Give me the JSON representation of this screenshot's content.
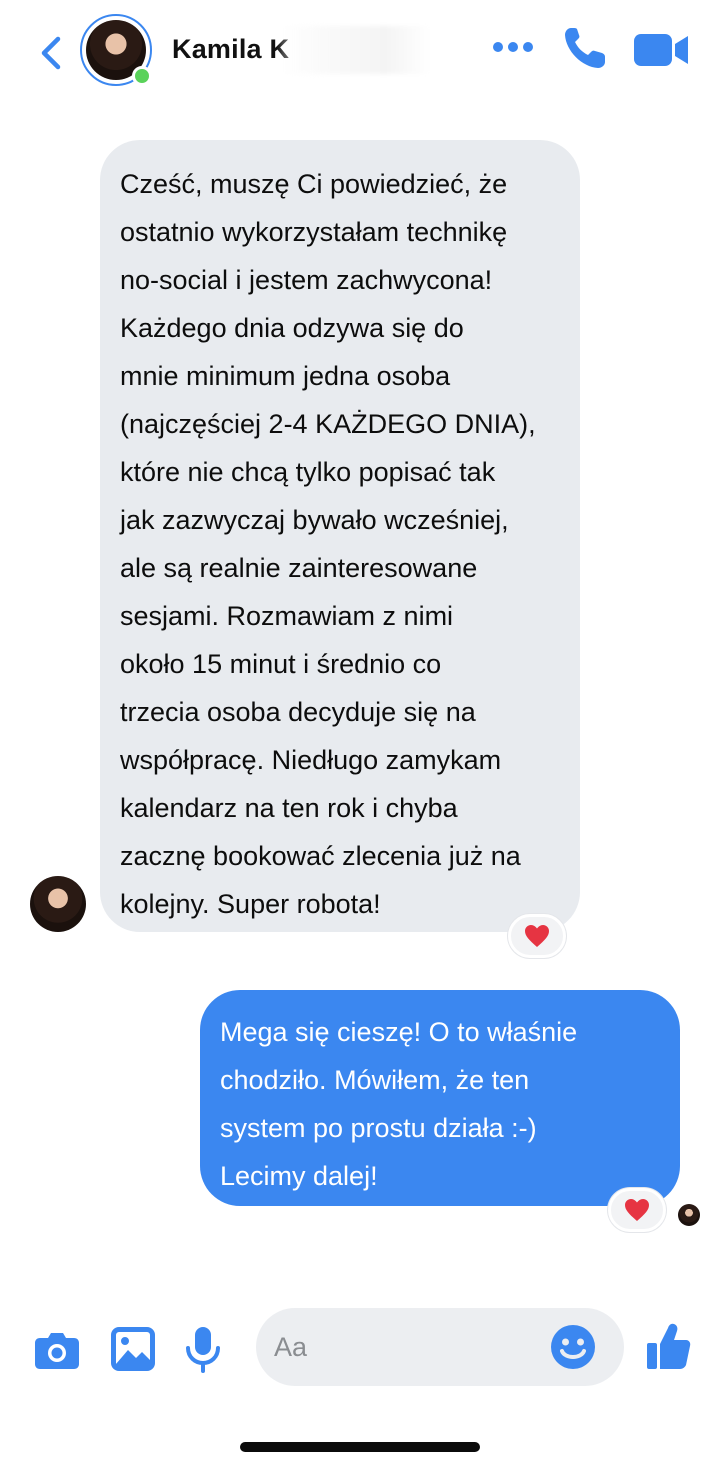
{
  "header": {
    "contact_name": "Kamila K",
    "back_icon": "chevron-left-icon",
    "status": "online",
    "actions": [
      "more-icon",
      "phone-icon",
      "video-icon"
    ],
    "accent_color": "#3b87f0"
  },
  "messages": [
    {
      "direction": "incoming",
      "text": "Cześć, muszę Ci powiedzieć, że\nostatnio wykorzystałam technikę\nno-social i jestem zachwycona!\nKażdego dnia odzywa się do\nmnie minimum jedna osoba\n(najczęściej 2-4 KAŻDEGO DNIA),\nktóre nie chcą tylko popisać tak\njak zazwyczaj bywało wcześniej,\nale są realnie zainteresowane\nsesjami. Rozmawiam z nimi\nokoło 15 minut i średnio co\ntrzecia osoba decyduje się na\nwspółpracę. Niedługo zamykam\nkalendarz na ten rok i chyba\nzacznę bookować zlecenia już na\nkolejny. Super robota!",
      "reaction": "❤️",
      "bubble_color": "#e8ebef"
    },
    {
      "direction": "outgoing",
      "text": "Mega się cieszę! O to właśnie\nchodziło. Mówiłem, że ten\nsystem po prostu działa :-)\nLecimy dalej!",
      "reaction": "❤️",
      "bubble_color": "#3b87f0"
    }
  ],
  "composer": {
    "placeholder": "Aa",
    "icons": [
      "camera-icon",
      "image-icon",
      "microphone-icon",
      "emoji-icon",
      "like-icon"
    ]
  }
}
